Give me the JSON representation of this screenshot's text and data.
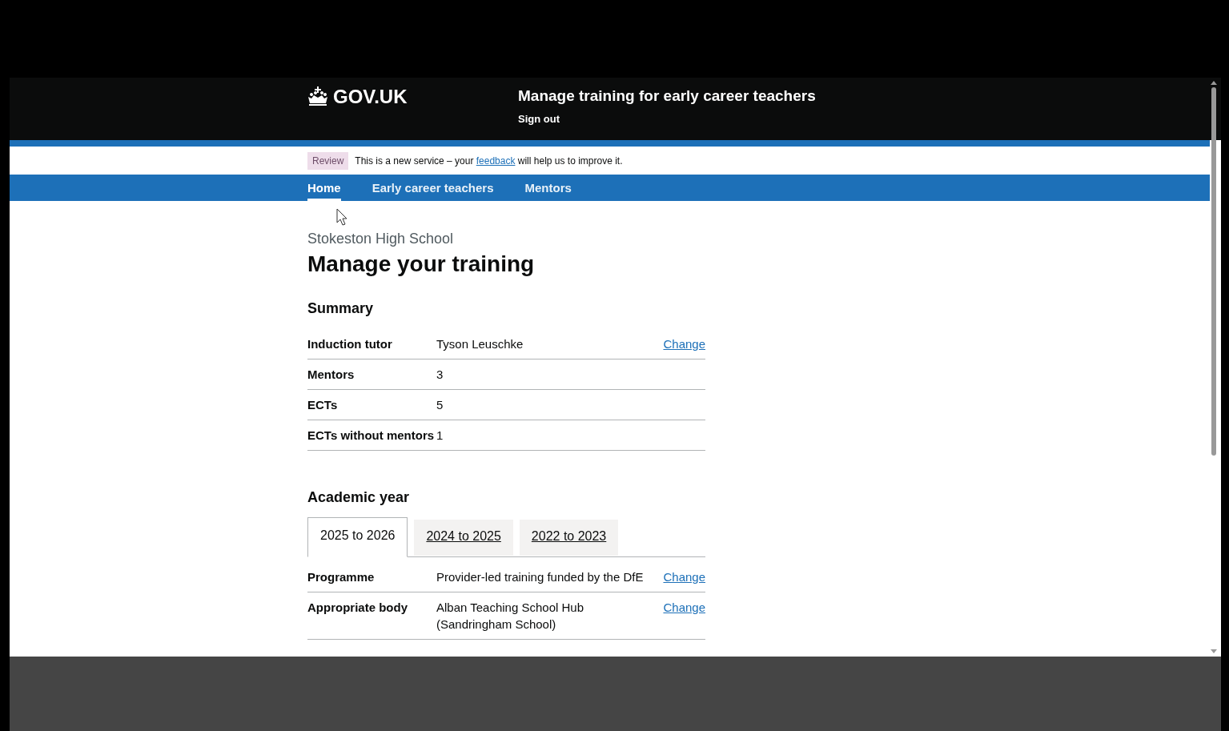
{
  "header": {
    "logo": "GOV.UK",
    "service_name": "Manage training for early career teachers",
    "sign_out": "Sign out"
  },
  "phase_banner": {
    "tag": "Review",
    "text": "This is a new service – your ",
    "link": "feedback",
    "text_after": " will help us to improve it."
  },
  "nav": [
    {
      "label": "Home",
      "selected": true
    },
    {
      "label": "Early career teachers",
      "selected": false
    },
    {
      "label": "Mentors",
      "selected": false
    }
  ],
  "caption": "Stokeston High School",
  "title": "Manage your training",
  "summary": {
    "heading": "Summary",
    "rows": [
      {
        "key": "Induction tutor",
        "value": "Tyson Leuschke",
        "action": "Change"
      },
      {
        "key": "Mentors",
        "value": "3"
      },
      {
        "key": "ECTs",
        "value": "5"
      },
      {
        "key": "ECTs without mentors",
        "value": "1"
      }
    ]
  },
  "academic_year": {
    "heading": "Academic year",
    "tabs": [
      {
        "label": "2025 to 2026",
        "selected": true
      },
      {
        "label": "2024 to 2025",
        "selected": false
      },
      {
        "label": "2022 to 2023",
        "selected": false
      }
    ],
    "rows": [
      {
        "key": "Programme",
        "value": [
          "Provider-led training funded by the DfE"
        ],
        "action": "Change"
      },
      {
        "key": "Appropriate body",
        "value": [
          "Alban Teaching School Hub",
          "(Sandringham School)"
        ],
        "action": "Change"
      }
    ]
  }
}
